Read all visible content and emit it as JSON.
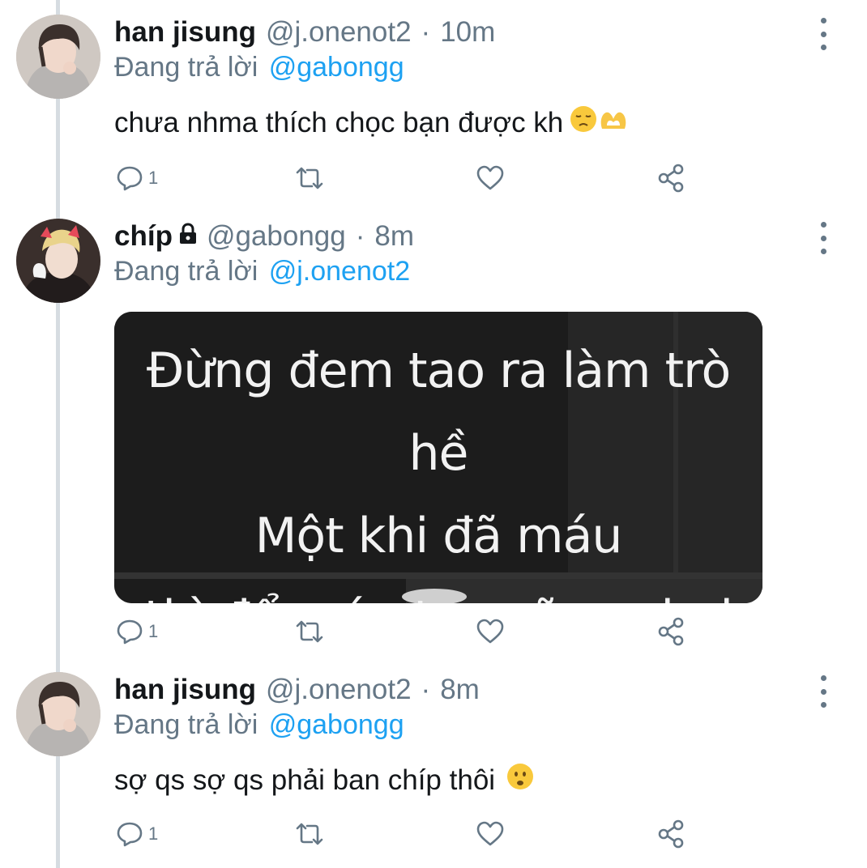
{
  "tweets": [
    {
      "name": "han jisung",
      "handle": "@j.onenot2",
      "separator": "·",
      "time": "10m",
      "reply_prefix": "Đang trả lời",
      "reply_to": "@gabongg",
      "text": "chưa nhma thích chọc bạn được kh",
      "emojis": [
        "pensive-face",
        "heart-hands"
      ],
      "reply_count": "1",
      "locked": false
    },
    {
      "name": "chíp",
      "handle": "@gabongg",
      "separator": "·",
      "time": "8m",
      "reply_prefix": "Đang trả lời",
      "reply_to": "@j.onenot2",
      "media_text": [
        "Đừng đem tao ra làm trò hề",
        "Một khi đã máu",
        "thì đổ máu tao cũng chơi"
      ],
      "reply_count": "1",
      "locked": true
    },
    {
      "name": "han jisung",
      "handle": "@j.onenot2",
      "separator": "·",
      "time": "8m",
      "reply_prefix": "Đang trả lời",
      "reply_to": "@gabongg",
      "text": "sợ qs sợ qs phải ban chíp thôi",
      "emojis": [
        "worried-face"
      ],
      "reply_count": "1",
      "locked": false
    }
  ],
  "icons": {
    "reply": "reply-icon",
    "retweet": "retweet-icon",
    "like": "like-icon",
    "share": "share-icon",
    "more": "more-icon",
    "lock": "lock-icon"
  },
  "colors": {
    "link": "#1da1f2",
    "secondary_text": "#657786",
    "primary_text": "#14171a",
    "thread_line": "#d6dce1"
  }
}
